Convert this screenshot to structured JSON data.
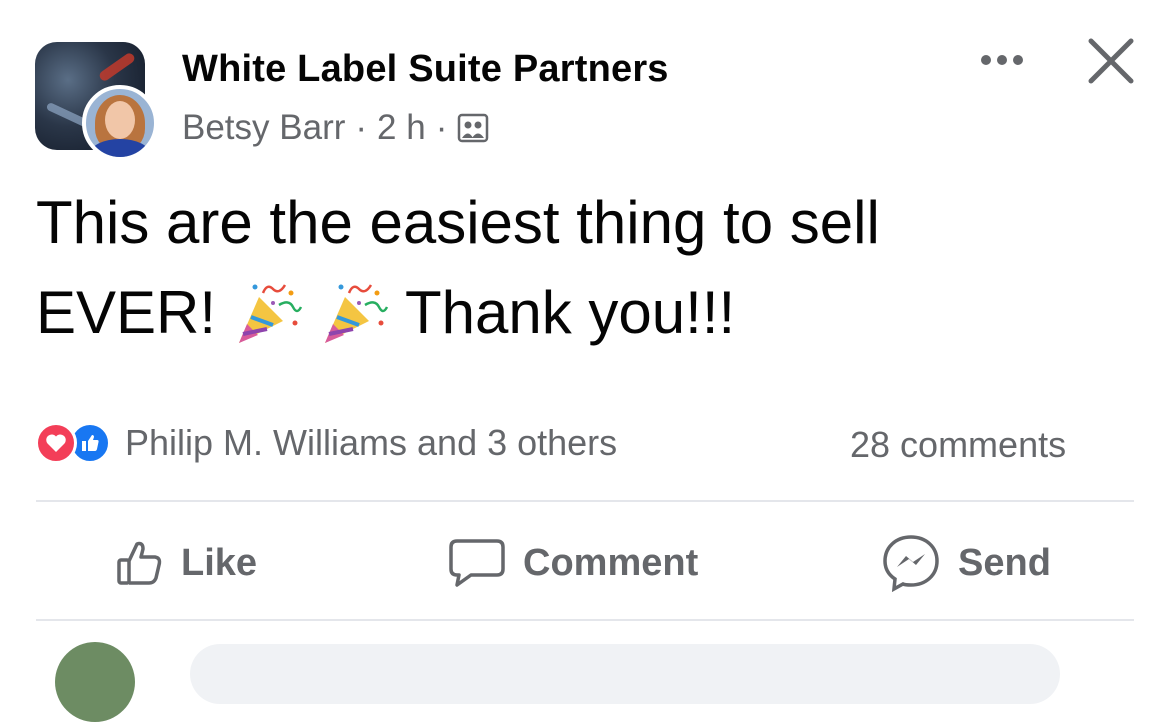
{
  "post": {
    "group_name": "White Label Suite Partners",
    "author": "Betsy Barr",
    "separator": "·",
    "time": "2 h",
    "audience_icon": "group-audience-icon",
    "text_line1": "This are the easiest thing to sell",
    "text_line2_start": "EVER!",
    "text_line2_end": "Thank you!!!",
    "emoji": "party-popper"
  },
  "reactions": {
    "types": [
      "love",
      "like"
    ],
    "summary": "Philip M. Williams and 3 others",
    "comments": "28 comments"
  },
  "actions": {
    "like": "Like",
    "comment": "Comment",
    "send": "Send"
  },
  "colors": {
    "secondary_text": "#65676b",
    "love": "#f33e58",
    "like": "#1877f2",
    "divider": "#e4e6eb"
  }
}
